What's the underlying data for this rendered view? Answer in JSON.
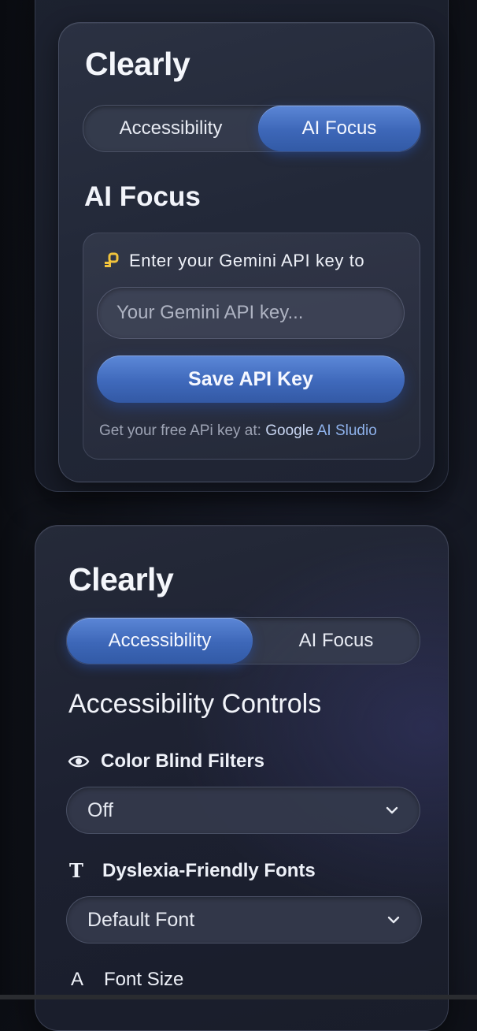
{
  "panel_top": {
    "title": "Clearly",
    "tabs": [
      {
        "label": "Accessibility",
        "active": false
      },
      {
        "label": "AI Focus",
        "active": true
      }
    ],
    "section_title": "AI Focus",
    "api_card": {
      "prompt_icon": "key-icon",
      "prompt": "Enter your Gemini API key to",
      "input_placeholder": "Your Gemini API key...",
      "input_value": "",
      "save_label": "Save API Key",
      "help_prefix": "Get your free APi key at: ",
      "help_link_1": "Google",
      "help_link_2": " AI Sludio"
    }
  },
  "panel_bottom": {
    "title": "Clearly",
    "tabs": [
      {
        "label": "Accessibility",
        "active": true
      },
      {
        "label": "AI Focus",
        "active": false
      }
    ],
    "section_title": "Accessibility Controls",
    "controls": [
      {
        "icon": "eye-icon",
        "label": "Color Blind Filters",
        "value": "Off"
      },
      {
        "icon": "text-icon",
        "label": "Dyslexia-Friendly Fonts",
        "value": "Default Font"
      },
      {
        "icon": "font-size-icon",
        "label": "Font Size"
      }
    ]
  },
  "colors": {
    "accent": "#3f69bb",
    "accent_light": "#5b86d6",
    "background": "#11141c",
    "panel": "#222838",
    "key_icon": "#f0c33c",
    "link": "#8fb2ec"
  }
}
